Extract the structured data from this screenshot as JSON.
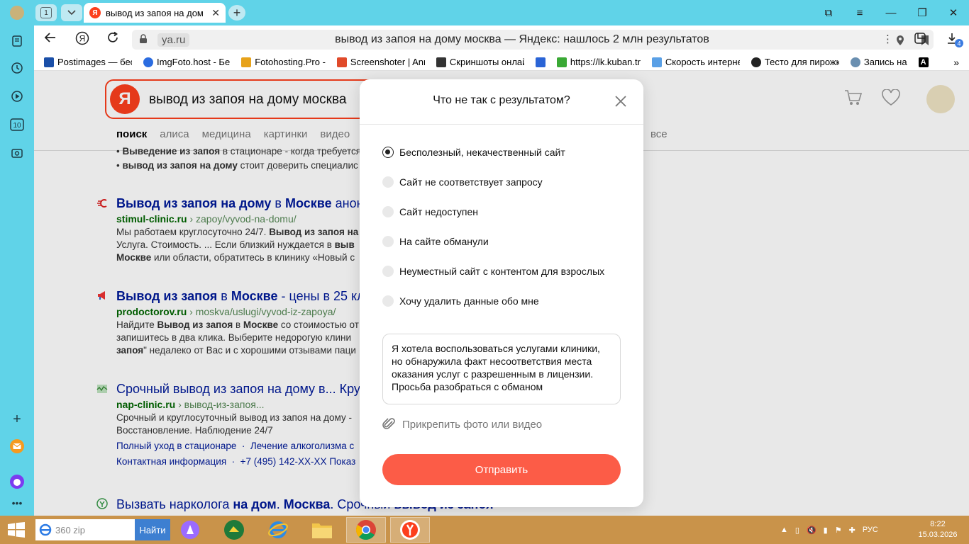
{
  "browser": {
    "tab_count": "1",
    "active_tab_title": "вывод из запоя на дом",
    "url_domain": "ya.ru",
    "page_title": "вывод из запоя на дому москва — Яндекс: нашлось 2 млн результатов",
    "downloads_badge": "4"
  },
  "bookmarks": [
    {
      "label": "Postimages — бес",
      "color": "#1a4fa8"
    },
    {
      "label": "ImgFoto.host - Бе",
      "color": "#2b6ce0"
    },
    {
      "label": "Fotohosting.Pro - ",
      "color": "#e7a21a"
    },
    {
      "label": "Screenshoter | Ann",
      "color": "#e04a2a"
    },
    {
      "label": "Скриншоты онлай",
      "color": "#333333"
    },
    {
      "label": "",
      "color": "#2a64d6"
    },
    {
      "label": "https://lk.kuban.tr",
      "color": "#3aa935"
    },
    {
      "label": "Скорость интерне",
      "color": "#5aa0e6"
    },
    {
      "label": "Тесто для пирожк",
      "color": "#222222"
    },
    {
      "label": "Запись на",
      "color": "#6a8fb0"
    }
  ],
  "search": {
    "query": "вывод из запоя на дому москва",
    "tabs": [
      "поиск",
      "алиса",
      "медицина",
      "картинки",
      "видео"
    ],
    "tab_all": "все"
  },
  "results": {
    "top_snippet_line1_bold": "Выведение из запоя",
    "top_snippet_line1_rest": " в стационаре - когда требуется",
    "top_snippet_line2_bold": "вывод из запоя на дому",
    "top_snippet_line2_rest": " стоит доверить специалис",
    "items": [
      {
        "title_a": "Вывод из запоя на дому",
        "title_b": " в ",
        "title_c": "Москве",
        "title_d": " анони",
        "domain": "stimul-clinic.ru",
        "path": " › zapoy/vyvod-na-domu/",
        "s1": "Мы работаем круглосуточно 24/7. ",
        "s1b": "Вывод из запоя на",
        "s2": "Услуга. Стоимость. ... Если близкий нуждается в ",
        "s2b": "выв",
        "s3b": "Москве",
        "s3": " или области, обратитесь в клинику «Новый с"
      },
      {
        "title_a": "Вывод из запоя",
        "title_b": " в ",
        "title_c": "Москве",
        "title_d": " - цены в 25 кли",
        "domain": "prodoctorov.ru",
        "path": " › moskva/uslugi/vyvod-iz-zapoya/",
        "s1": "Найдите ",
        "s1b": "Вывод из запоя",
        "s1c": " в ",
        "s1d": "Москве",
        "s1e": " со стоимостью от",
        "s2": "запишитесь в два клика. Выберите недорогую клини",
        "s3b": "запоя",
        "s3": "\" недалеко от Вас и с хорошими отзывами паци"
      },
      {
        "title_a": "Срочный вывод из запоя на дому в... Кру",
        "domain": "nap-clinic.ru",
        "path": " › вывод-из-запоя...",
        "s1": "Срочный и круглосуточный вывод из запоя на дому -",
        "s2": "Восстановление. Наблюдение 24/7",
        "links1": [
          "Полный уход в стационаре",
          "Лечение алкоголизма с"
        ],
        "links2": [
          "Контактная информация",
          "+7 (495) 142-XX-XX Показ"
        ]
      },
      {
        "title_a": "Вызвать нарколога ",
        "title_b": "на дом",
        "title_c": ". ",
        "title_d": "Москва",
        "title_e": ". Срочный ",
        "title_f": "вывод из запоя"
      }
    ]
  },
  "modal": {
    "title": "Что не так с результатом?",
    "options": [
      {
        "label": "Бесполезный, некачественный сайт",
        "checked": true
      },
      {
        "label": "Сайт не соответствует запросу",
        "checked": false
      },
      {
        "label": "Сайт недоступен",
        "checked": false
      },
      {
        "label": "На сайте обманули",
        "checked": false
      },
      {
        "label": "Неуместный сайт с контентом для взрослых",
        "checked": false
      },
      {
        "label": "Хочу удалить данные обо мне",
        "checked": false
      }
    ],
    "comment": "Я хотела воспользоваться услугами клиники, но обнаружила факт несоответствия места оказания услуг с разрешенным в лицензии. Просьба разобраться с обманом",
    "attach_label": "Прикрепить фото или видео",
    "submit_label": "Отправить"
  },
  "taskbar": {
    "search_value": "360 zip",
    "find_label": "Найти",
    "lang": "РУС",
    "time": "8:22",
    "date": "15.03.2026"
  },
  "colors": {
    "browser_chrome": "#60d3e8",
    "yandex_red": "#fc3f1d",
    "submit_button": "#fc5c47",
    "link_blue": "#001a99",
    "url_green": "#006600",
    "taskbar": "#c9934a"
  }
}
